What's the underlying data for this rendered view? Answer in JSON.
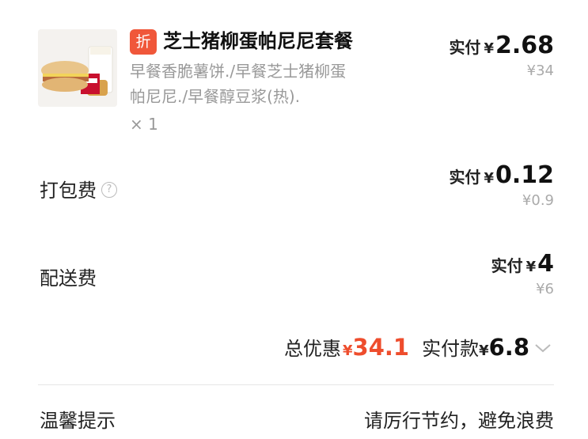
{
  "item": {
    "badge": "折",
    "title": "芝士猪柳蛋帕尼尼套餐",
    "desc_line1": "早餐香脆薯饼./早餐芝士猪柳蛋",
    "desc_line2": "帕尼尼./早餐醇豆浆(热).",
    "qty": "× 1",
    "pay_label": "实付",
    "yen": "¥",
    "pay_value": "2.68",
    "orig": "¥34",
    "image_icon": "kfc-breakfast-combo-image"
  },
  "packing": {
    "label": "打包费",
    "help_icon": "question-circle-icon",
    "help_glyph": "?",
    "pay_label": "实付",
    "yen": "¥",
    "pay_value": "0.12",
    "orig": "¥0.9"
  },
  "delivery": {
    "label": "配送费",
    "pay_label": "实付",
    "yen": "¥",
    "pay_value": "4",
    "orig": "¥6"
  },
  "summary": {
    "discount_label": "总优惠",
    "discount_yen": "¥",
    "discount_value": "34.1",
    "paid_label": "实付款",
    "paid_yen": "¥",
    "paid_value": "6.8",
    "expand_icon": "chevron-down-icon"
  },
  "tip": {
    "label": "温馨提示",
    "text": "请厉行节约，避免浪费"
  },
  "colors": {
    "accent_red": "#ee4d2d",
    "badge_bg": "#f0573a",
    "muted_text": "#999999"
  }
}
